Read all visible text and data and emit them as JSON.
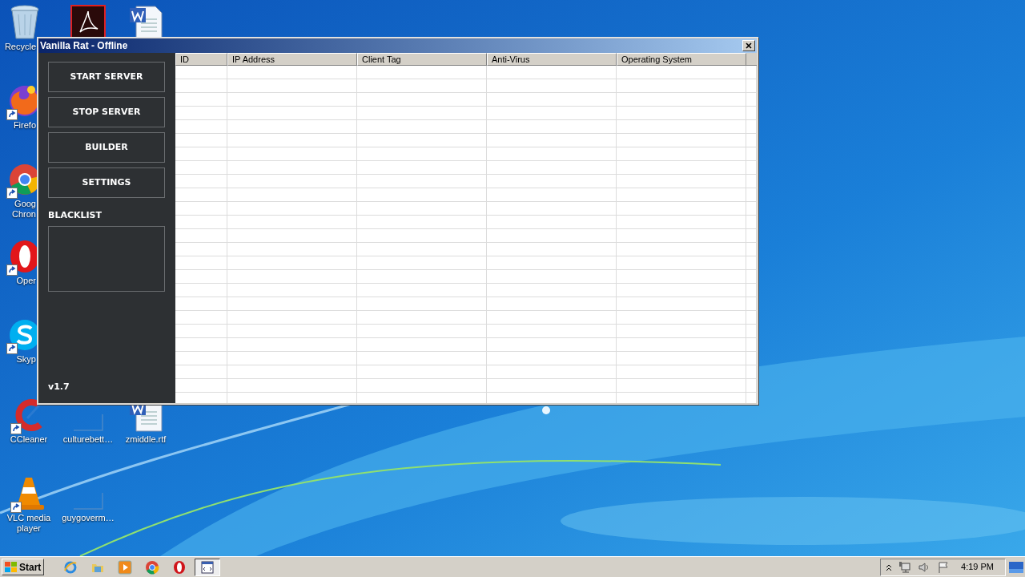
{
  "desktop": {
    "icons": [
      {
        "kind": "recycle",
        "lines": [
          "Recycle"
        ],
        "shortcut": false
      },
      {
        "kind": "pdf",
        "shortcut": false
      },
      {
        "kind": "word",
        "shortcut": false
      },
      {
        "kind": "firefox",
        "lines": [
          "Firefo"
        ],
        "shortcut": true
      },
      {
        "kind": "chrome",
        "lines": [
          "Goog",
          "Chron"
        ],
        "shortcut": true
      },
      {
        "kind": "opera",
        "lines": [
          "Oper"
        ],
        "shortcut": true
      },
      {
        "kind": "skype",
        "lines": [
          "Skyp"
        ],
        "shortcut": true
      },
      {
        "kind": "ccleaner",
        "lines": [
          "CCleaner"
        ],
        "shortcut": true
      },
      {
        "kind": "blank",
        "lines": [
          "culturebett…"
        ],
        "shortcut": false
      },
      {
        "kind": "word",
        "lines": [
          "zmiddle.rtf"
        ],
        "shortcut": false
      },
      {
        "kind": "vlc",
        "lines": [
          "VLC media",
          "player"
        ],
        "shortcut": true
      },
      {
        "kind": "blank",
        "lines": [
          "guygoverm…"
        ],
        "shortcut": false
      }
    ]
  },
  "window": {
    "title": "Vanilla Rat - Offline",
    "sidebar": {
      "buttons": [
        "START SERVER",
        "STOP SERVER",
        "BUILDER",
        "SETTINGS"
      ],
      "blacklist_label": "BLACKLIST",
      "version": "v1.7"
    },
    "table": {
      "columns": [
        "ID",
        "IP Address",
        "Client Tag",
        "Anti-Virus",
        "Operating System"
      ]
    }
  },
  "taskbar": {
    "start": "Start",
    "apps": [
      {
        "kind": "ie",
        "selected": false
      },
      {
        "kind": "folder",
        "selected": false
      },
      {
        "kind": "media",
        "selected": false
      },
      {
        "kind": "chrome",
        "selected": false
      },
      {
        "kind": "opera",
        "selected": false
      },
      {
        "kind": "window",
        "selected": true
      }
    ],
    "clock": "4:19 PM"
  }
}
